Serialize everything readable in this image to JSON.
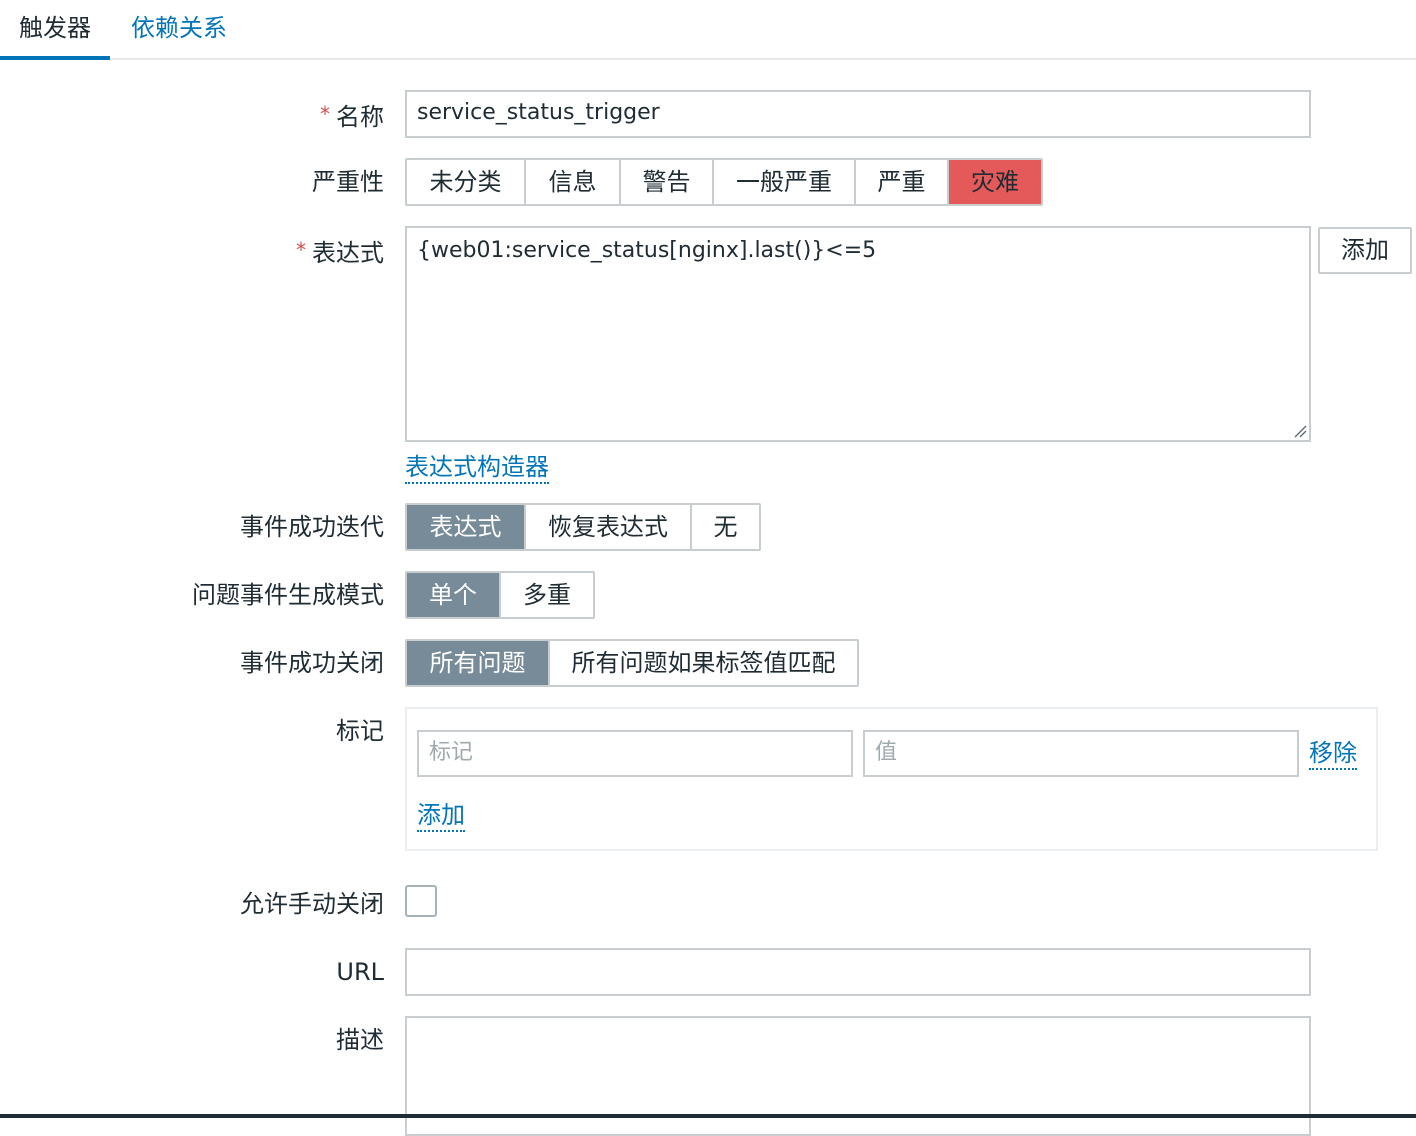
{
  "tabs": {
    "active": "触发器",
    "other": "依赖关系"
  },
  "form": {
    "name": {
      "required": "*",
      "label": "名称",
      "value": "service_status_trigger"
    },
    "severity": {
      "label": "严重性",
      "options": [
        "未分类",
        "信息",
        "警告",
        "一般严重",
        "严重",
        "灾难"
      ],
      "selected": "灾难",
      "selected_color": "#e45959"
    },
    "expression": {
      "required": "*",
      "label": "表达式",
      "value": "{web01:service_status[nginx].last()}<=5",
      "add_button": "添加",
      "constructor_link": "表达式构造器"
    },
    "ok_event_generation": {
      "label": "事件成功迭代",
      "options": [
        "表达式",
        "恢复表达式",
        "无"
      ],
      "selected": "表达式"
    },
    "problem_event_mode": {
      "label": "问题事件生成模式",
      "options": [
        "单个",
        "多重"
      ],
      "selected": "单个"
    },
    "ok_event_closes": {
      "label": "事件成功关闭",
      "options": [
        "所有问题",
        "所有问题如果标签值匹配"
      ],
      "selected": "所有问题"
    },
    "tags": {
      "label": "标记",
      "tag_placeholder": "标记",
      "value_placeholder": "值",
      "remove_link": "移除",
      "add_link": "添加"
    },
    "manual_close": {
      "label": "允许手动关闭",
      "checked": false
    },
    "url": {
      "label": "URL",
      "value": ""
    },
    "description": {
      "label": "描述",
      "value": ""
    }
  },
  "colors": {
    "accent": "#0275b8",
    "selected_segment": "#778b99",
    "disaster": "#e45959"
  }
}
